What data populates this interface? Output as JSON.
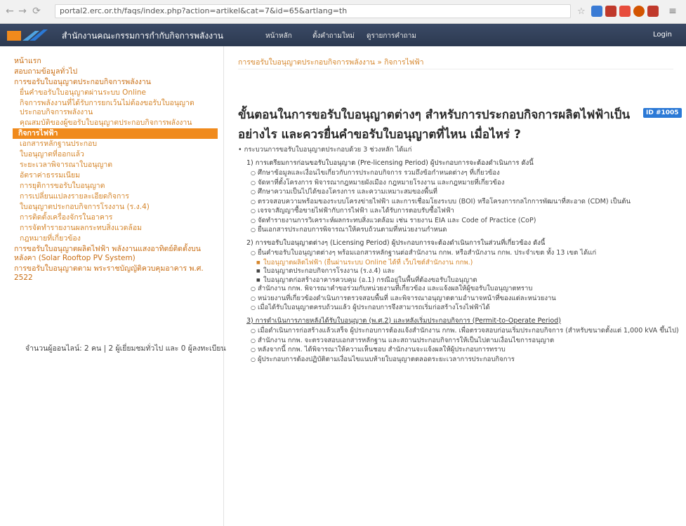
{
  "browser": {
    "url": "portal2.erc.or.th/faqs/index.php?action=artikel&cat=7&id=65&artlang=th"
  },
  "header": {
    "site_name": "สำนักงานคณะกรรมการกำกับกิจการพลังงาน",
    "nav": [
      "หน้าหลัก",
      "ตั้งคำถามใหม่",
      "ดูรายการคำถาม"
    ],
    "login": "Login"
  },
  "sidebar": {
    "items": [
      {
        "label": "หน้าแรก",
        "kind": "top"
      },
      {
        "label": "สอบถามข้อมูลทั่วไป",
        "kind": "top"
      },
      {
        "label": "การขอรับใบอนุญาตประกอบกิจการพลังงาน",
        "kind": "top"
      },
      {
        "label": "ยื่นคำขอรับใบอนุญาตผ่านระบบ Online",
        "kind": "sub"
      },
      {
        "label": "กิจการพลังงานที่ได้รับการยกเว้นไม่ต้องขอรับใบอนุญาตประกอบกิจการพลังงาน",
        "kind": "sub"
      },
      {
        "label": "คุณสมบัติของผู้ขอรับใบอนุญาตประกอบกิจการพลังงาน",
        "kind": "sub"
      },
      {
        "label": "กิจการไฟฟ้า",
        "kind": "active"
      },
      {
        "label": "เอกสารหลักฐานประกอบ",
        "kind": "sub"
      },
      {
        "label": "ใบอนุญาตที่ออกแล้ว",
        "kind": "sub"
      },
      {
        "label": "ระยะเวลาพิจารณาใบอนุญาต",
        "kind": "sub"
      },
      {
        "label": "อัตราค่าธรรมเนียม",
        "kind": "sub"
      },
      {
        "label": "การยุติการขอรับใบอนุญาต",
        "kind": "sub"
      },
      {
        "label": "การเปลี่ยนแปลงรายละเอียดกิจการ",
        "kind": "sub"
      },
      {
        "label": "ใบอนุญาตประกอบกิจการโรงงาน (ร.ง.4)",
        "kind": "sub"
      },
      {
        "label": "การติดตั้งเครื่องจักรในอาคาร",
        "kind": "sub"
      },
      {
        "label": "การจัดทำรายงานผลกระทบสิ่งแวดล้อม",
        "kind": "sub"
      },
      {
        "label": "กฎหมายที่เกี่ยวข้อง",
        "kind": "sub"
      },
      {
        "label": "การขอรับใบอนุญาตผลิตไฟฟ้า พลังงานแสงอาทิตย์ติดตั้งบนหลังคา (Solar Rooftop PV System)",
        "kind": "solar"
      },
      {
        "label": "การขอรับใบอนุญาตตาม พระราชบัญญัติควบคุมอาคาร พ.ศ. 2522",
        "kind": "solar"
      }
    ],
    "visitor_count": "จำนวนผู้ออนไลน์: 2 คน | 2 ผู้เยี่ยมชมทั่วไป และ 0 ผู้ลงทะเบียน"
  },
  "main": {
    "breadcrumb": "การขอรับใบอนุญาตประกอบกิจการพลังงาน » กิจการไฟฟ้า",
    "title": "ขั้นตอนในการขอรับใบอนุญาตต่างๆ สำหรับการประกอบกิจการผลิตไฟฟ้าเป็นอย่างไร และควรยื่นคำขอรับใบอนุญาตที่ไหน เมื่อไหร่ ?",
    "id_badge": "ID #1005",
    "intro": "• กระบวนการขอรับใบอนุญาตประกอบด้วย 3 ช่วงหลัก ได้แก่",
    "section1": "1) การเตรียมการก่อนขอรับใบอนุญาต (Pre-licensing Period) ผู้ประกอบการจะต้องดำเนินการ ดังนี้",
    "section1_items": [
      "ศึกษาข้อมูลและเงื่อนไขเกี่ยวกับการประกอบกิจการ รวมถึงข้อกำหนดต่างๆ ที่เกี่ยวข้อง",
      "จัดหาที่ตั้งโครงการ พิจารณากฎหมายผังเมือง กฎหมายโรงงาน และกฎหมายที่เกี่ยวข้อง",
      "ศึกษาความเป็นไปได้ของโครงการ และความเหมาะสมของพื้นที่",
      "ตรวจสอบความพร้อมของระบบโครงข่ายไฟฟ้า และการเชื่อมโยงระบบ (BOI) หรือโครงการกลไกการพัฒนาที่สะอาด (CDM) เป็นต้น",
      "เจรจาสัญญาซื้อขายไฟฟ้ากับการไฟฟ้า และได้รับการตอบรับซื้อไฟฟ้า",
      "จัดทำรายงานการวิเคราะห์ผลกระทบสิ่งแวดล้อม เช่น รายงาน EIA และ Code of Practice (CoP)",
      "ยื่นเอกสารประกอบการพิจารณาให้ครบถ้วนตามที่หน่วยงานกำหนด"
    ],
    "section2": "2) การขอรับใบอนุญาตต่างๆ (Licensing Period) ผู้ประกอบการจะต้องดำเนินการในส่วนที่เกี่ยวข้อง ดังนี้",
    "section2_items": [
      "ยื่นคำขอรับใบอนุญาตต่างๆ พร้อมเอกสารหลักฐานต่อสำนักงาน กกพ. หรือสำนักงาน กกพ. ประจำเขต ทั้ง 13 เขต ได้แก่",
      "สำนักงาน กกพ. พิจารณาคำขอร่วมกับหน่วยงานที่เกี่ยวข้อง และแจ้งผลให้ผู้ขอรับใบอนุญาตทราบ",
      "หน่วยงานที่เกี่ยวข้องดำเนินการตรวจสอบพื้นที่ และพิจารณาอนุญาตตามอำนาจหน้าที่ของแต่ละหน่วยงาน",
      "เมื่อได้รับใบอนุญาตครบถ้วนแล้ว ผู้ประกอบการจึงสามารถเริ่มก่อสร้างโรงไฟฟ้าได้"
    ],
    "section2_sub": [
      "ใบอนุญาตผลิตไฟฟ้า (ยื่นผ่านระบบ Online ได้ที่ เว็บไซต์สำนักงาน กกพ.)",
      "ใบอนุญาตประกอบกิจการโรงงาน (ร.ง.4) และ",
      "ใบอนุญาตก่อสร้างอาคารควบคุม (อ.1) กรณีอยู่ในพื้นที่ต้องขอรับใบอนุญาต"
    ],
    "section3": "3) การดำเนินการภายหลังได้รับใบอนุญาต (พ.ศ.2) และหลังเริ่มประกอบกิจการ (Permit-to-Operate Period)",
    "section3_items": [
      "เมื่อดำเนินการก่อสร้างแล้วเสร็จ ผู้ประกอบการต้องแจ้งสำนักงาน กกพ. เพื่อตรวจสอบก่อนเริ่มประกอบกิจการ (สำหรับขนาดตั้งแต่ 1,000 kVA ขึ้นไป)",
      "สำนักงาน กกพ. จะตรวจสอบเอกสารหลักฐาน และสถานประกอบกิจการให้เป็นไปตามเงื่อนไขการอนุญาต",
      "หลังจากนี้ กกพ. ได้พิจารณาให้ความเห็นชอบ สำนักงานจะแจ้งผลให้ผู้ประกอบการทราบ",
      "ผู้ประกอบการต้องปฏิบัติตามเงื่อนไขแนบท้ายใบอนุญาตตลอดระยะเวลาการประกอบกิจการ"
    ]
  }
}
